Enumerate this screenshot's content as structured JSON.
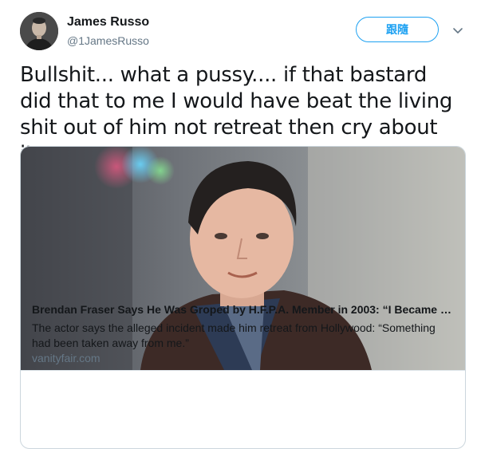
{
  "tweet": {
    "user": {
      "display_name": "James Russo",
      "handle": "@1JamesRusso"
    },
    "follow_label": "跟隨",
    "text": "Bullshit...  what a pussy.... if that bastard did that to me I would have beat the living shit out of him not retreat then cry about it.",
    "card": {
      "title": "Brendan Fraser Says He Was Groped by H.F.P.A. Member in 2003: “I Became Depressed”",
      "description": "The actor says the alleged incident made him retreat from Hollywood: “Something had been taken away from me.”",
      "domain": "vanityfair.com"
    }
  },
  "icons": {
    "menu": "chevron-down-icon"
  },
  "colors": {
    "accent": "#1da1f2",
    "secondary_text": "#657786",
    "border": "#ccd6dd"
  }
}
